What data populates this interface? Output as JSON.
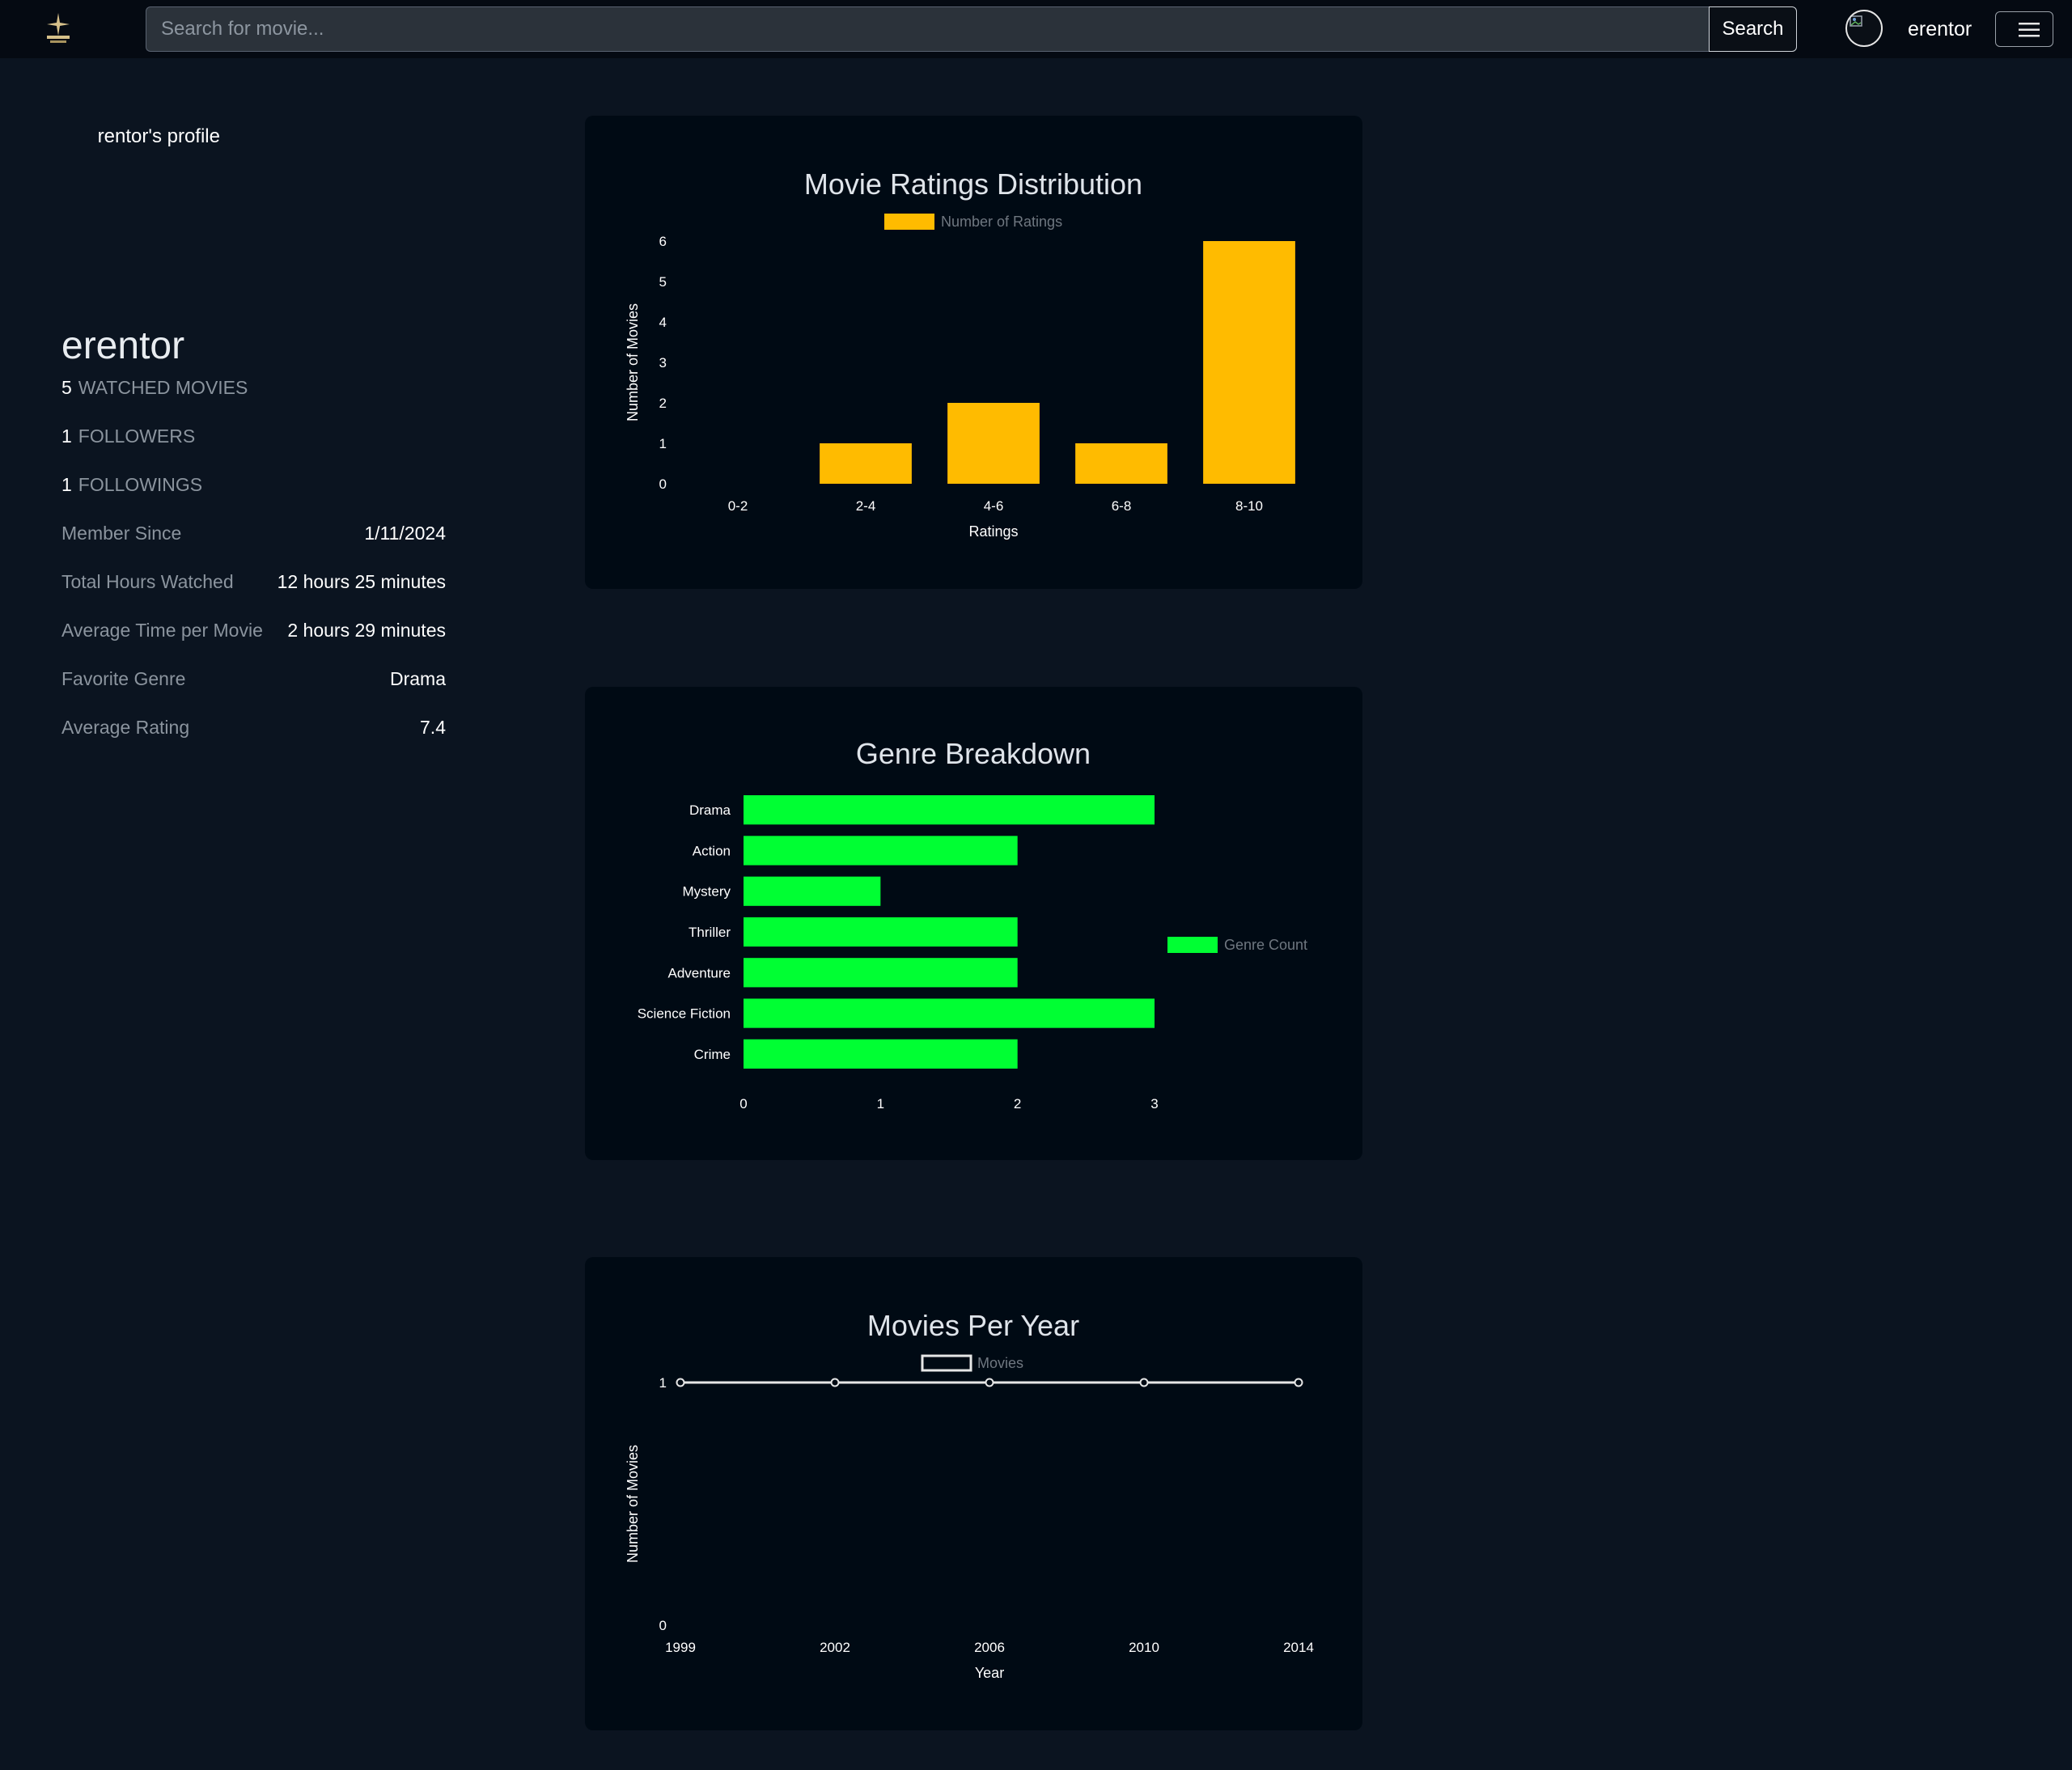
{
  "navbar": {
    "search_placeholder": "Search for movie...",
    "search_button": "Search",
    "username": "erentor"
  },
  "profile": {
    "image_alt": "erentor's profile",
    "name": "erentor",
    "watched_count": "5",
    "watched_label": "WATCHED MOVIES",
    "followers_count": "1",
    "followers_label": "FOLLOWERS",
    "followings_count": "1",
    "followings_label": "FOLLOWINGS",
    "info": [
      {
        "label": "Member Since",
        "value": "1/11/2024"
      },
      {
        "label": "Total Hours Watched",
        "value": "12 hours 25 minutes"
      },
      {
        "label": "Average Time per Movie",
        "value": "2 hours 29 minutes"
      },
      {
        "label": "Favorite Genre",
        "value": "Drama"
      },
      {
        "label": "Average Rating",
        "value": "7.4"
      }
    ]
  },
  "colors": {
    "ratings_bar": "#ffbb00",
    "genre_bar": "#00ff33",
    "line": "#e6e6e6"
  },
  "chart_data": [
    {
      "type": "bar",
      "title": "Movie Ratings Distribution",
      "categories": [
        "0-2",
        "2-4",
        "4-6",
        "6-8",
        "8-10"
      ],
      "series": [
        {
          "name": "Number of Ratings",
          "values": [
            0,
            1,
            2,
            1,
            6
          ]
        }
      ],
      "xlabel": "Ratings",
      "ylabel": "Number of Movies",
      "ylim": [
        0,
        6
      ],
      "yticks": [
        0,
        1,
        2,
        3,
        4,
        5,
        6
      ],
      "legend": "top",
      "grid": false
    },
    {
      "type": "bar",
      "orientation": "horizontal",
      "title": "Genre Breakdown",
      "categories": [
        "Drama",
        "Action",
        "Mystery",
        "Thriller",
        "Adventure",
        "Science Fiction",
        "Crime"
      ],
      "series": [
        {
          "name": "Genre Count",
          "values": [
            3,
            2,
            1,
            2,
            2,
            3,
            2
          ]
        }
      ],
      "xlim": [
        0,
        3
      ],
      "xticks": [
        0,
        1,
        2,
        3
      ],
      "legend": "right",
      "grid": false
    },
    {
      "type": "line",
      "title": "Movies Per Year",
      "x": [
        "1999",
        "2002",
        "2006",
        "2010",
        "2014"
      ],
      "series": [
        {
          "name": "Movies",
          "values": [
            1,
            1,
            1,
            1,
            1
          ]
        }
      ],
      "xlabel": "Year",
      "ylabel": "Number of Movies",
      "ylim": [
        0,
        1
      ],
      "yticks": [
        0,
        1
      ],
      "legend": "top",
      "grid": false
    }
  ]
}
